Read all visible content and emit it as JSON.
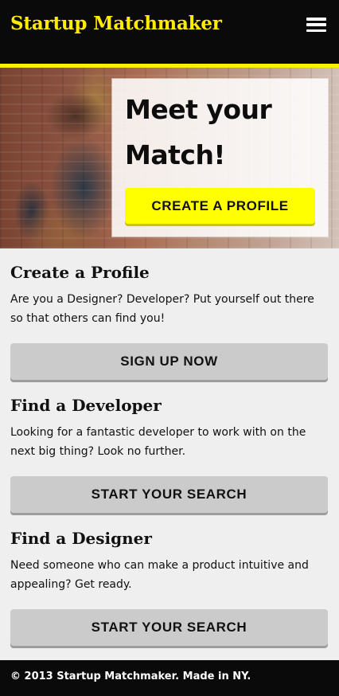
{
  "header": {
    "brand": "Startup Matchmaker",
    "menu_icon": "hamburger-menu-icon"
  },
  "hero": {
    "heading_line1": "Meet your",
    "heading_line2": "Match!",
    "button_label": "CREATE A PROFILE",
    "button_color": "#ffff00"
  },
  "sections": [
    {
      "title": "Create a Profile",
      "description": "Are you a Designer? Developer? Put yourself out there so that others can find you!",
      "button_label": "SIGN UP NOW"
    },
    {
      "title": "Find a Developer",
      "description": "Looking for a fantastic developer to work with on the next big thing? Look no further.",
      "button_label": "START YOUR SEARCH"
    },
    {
      "title": "Find a Designer",
      "description": "Need someone who can make a product intuitive and appealing? Get ready.",
      "button_label": "START YOUR SEARCH"
    }
  ],
  "footer": {
    "text": "© 2013 Startup Matchmaker. Made in NY."
  },
  "colors": {
    "accent": "#ffec00",
    "header_bg": "#0a0a0a",
    "button_gray": "#cbcbcb"
  }
}
